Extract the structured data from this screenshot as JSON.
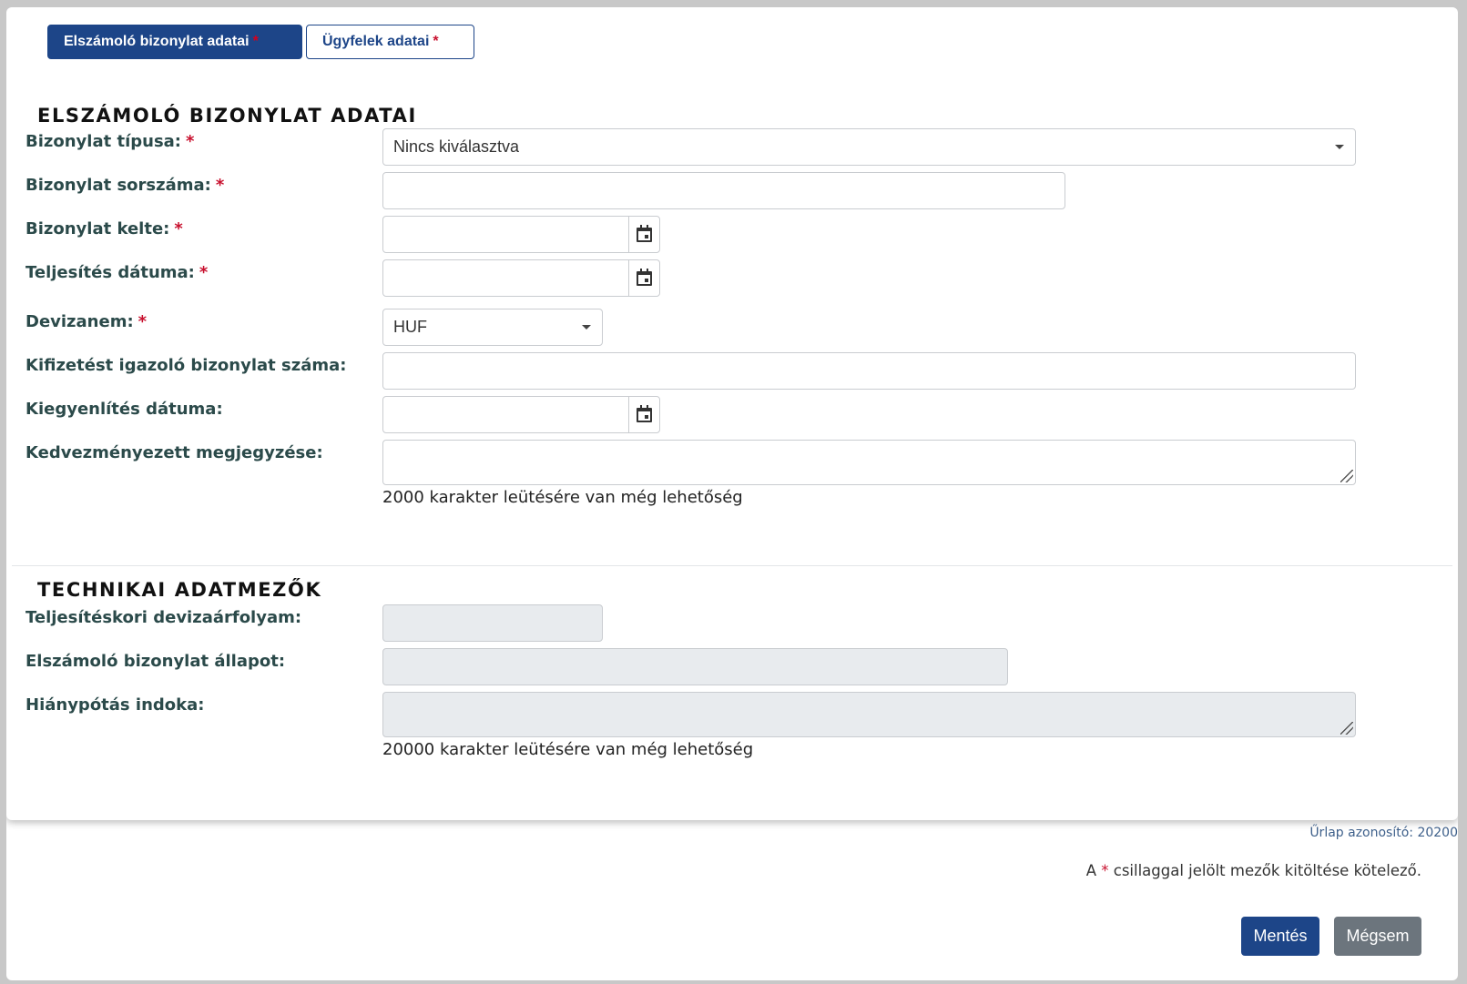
{
  "tabs": [
    {
      "label": "Elszámoló bizonylat adatai",
      "required_mark": "*",
      "active": true
    },
    {
      "label": "Ügyfelek adatai",
      "required_mark": "*",
      "active": false
    }
  ],
  "section1": {
    "title": "ELSZÁMOLÓ BIZONYLAT ADATAI",
    "fields": {
      "doc_type": {
        "label": "Bizonylat típusa:",
        "required_mark": "*",
        "value": "Nincs kiválasztva"
      },
      "doc_number": {
        "label": "Bizonylat sorszáma:",
        "required_mark": "*",
        "value": ""
      },
      "doc_date": {
        "label": "Bizonylat kelte:",
        "required_mark": "*",
        "value": ""
      },
      "fulfillment_date": {
        "label": "Teljesítés dátuma:",
        "required_mark": "*",
        "value": ""
      },
      "currency": {
        "label": "Devizanem:",
        "required_mark": "*",
        "value": "HUF"
      },
      "payment_doc_number": {
        "label": "Kifizetést igazoló bizonylat száma:",
        "value": ""
      },
      "settlement_date": {
        "label": "Kiegyenlítés dátuma:",
        "value": ""
      },
      "beneficiary_note": {
        "label": "Kedvezményezett megjegyzése:",
        "value": "",
        "counter": "2000 karakter leütésére van még lehetőség"
      }
    }
  },
  "section2": {
    "title": "TECHNIKAI ADATMEZŐK",
    "fields": {
      "exchange_rate": {
        "label": "Teljesítéskori devizaárfolyam:",
        "value": ""
      },
      "doc_status": {
        "label": "Elszámoló bizonylat állapot:",
        "value": ""
      },
      "deficiency_reason": {
        "label": "Hiánypótás indoka:",
        "value": "",
        "counter": "20000 karakter leütésére van még lehetőség"
      }
    }
  },
  "footer": {
    "form_id": "Űrlap azonosító: 20200",
    "note_prefix": "A",
    "note_star": "*",
    "note_suffix": "csillaggal jelölt mezők kitöltése kötelező.",
    "save_label": "Mentés",
    "cancel_label": "Mégsem"
  },
  "icons": {
    "calendar": "calendar-icon",
    "dropdown": "chevron-down-icon",
    "resize": "resize-handle-icon"
  },
  "colors": {
    "primary": "#1d4588",
    "required": "#c8102e",
    "secondary_button": "#6c757d",
    "disabled_field": "#e8ebee"
  }
}
